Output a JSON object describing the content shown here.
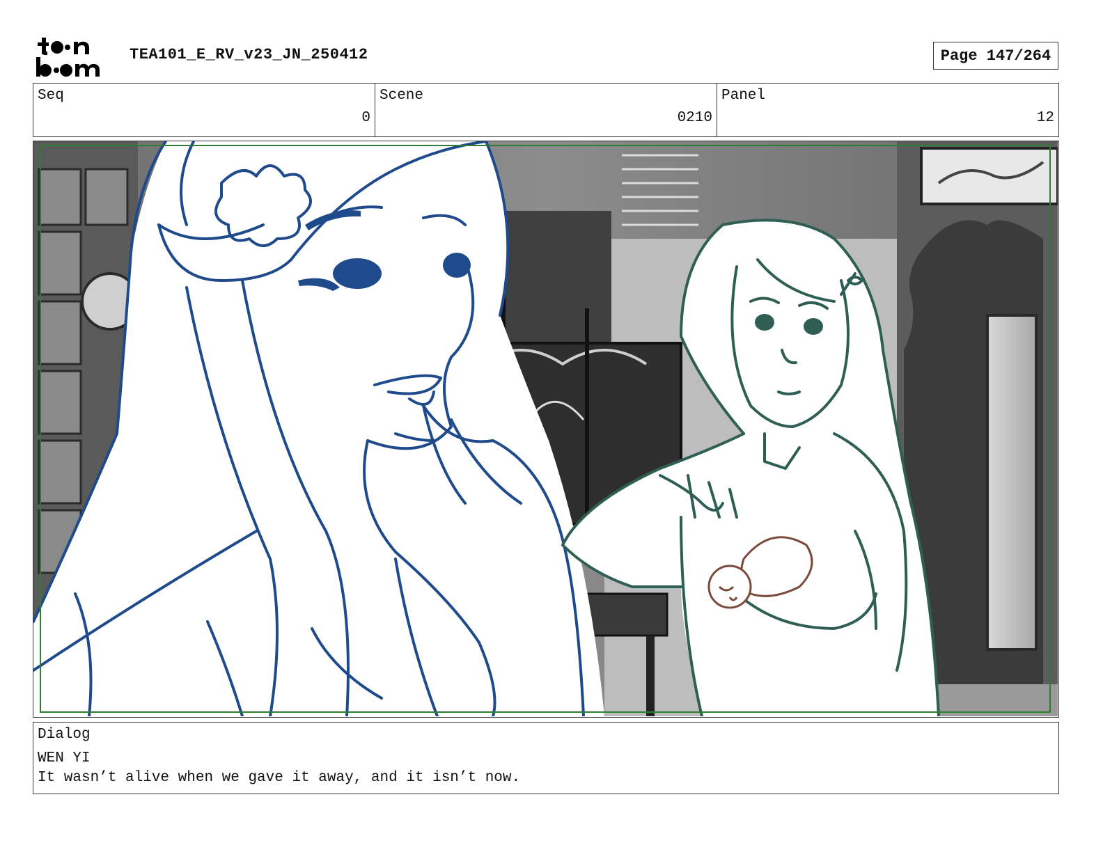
{
  "header": {
    "logo_text": "toon boom",
    "document_title": "TEA101_E_RV_v23_JN_250412",
    "page_label": "Page 147/264"
  },
  "info": {
    "seq_label": "Seq",
    "seq_value": "0",
    "scene_label": "Scene",
    "scene_value": "0210",
    "panel_label": "Panel",
    "panel_value": "12"
  },
  "dialog": {
    "label": "Dialog",
    "speaker": "WEN YI",
    "line": "It wasn’t alive when we gave it away, and it isn’t now."
  },
  "colors": {
    "blue_character": "#1f4a8c",
    "green_character": "#2f5e52",
    "creature": "#7a4a3a",
    "safe_frame": "#2e7d32"
  }
}
